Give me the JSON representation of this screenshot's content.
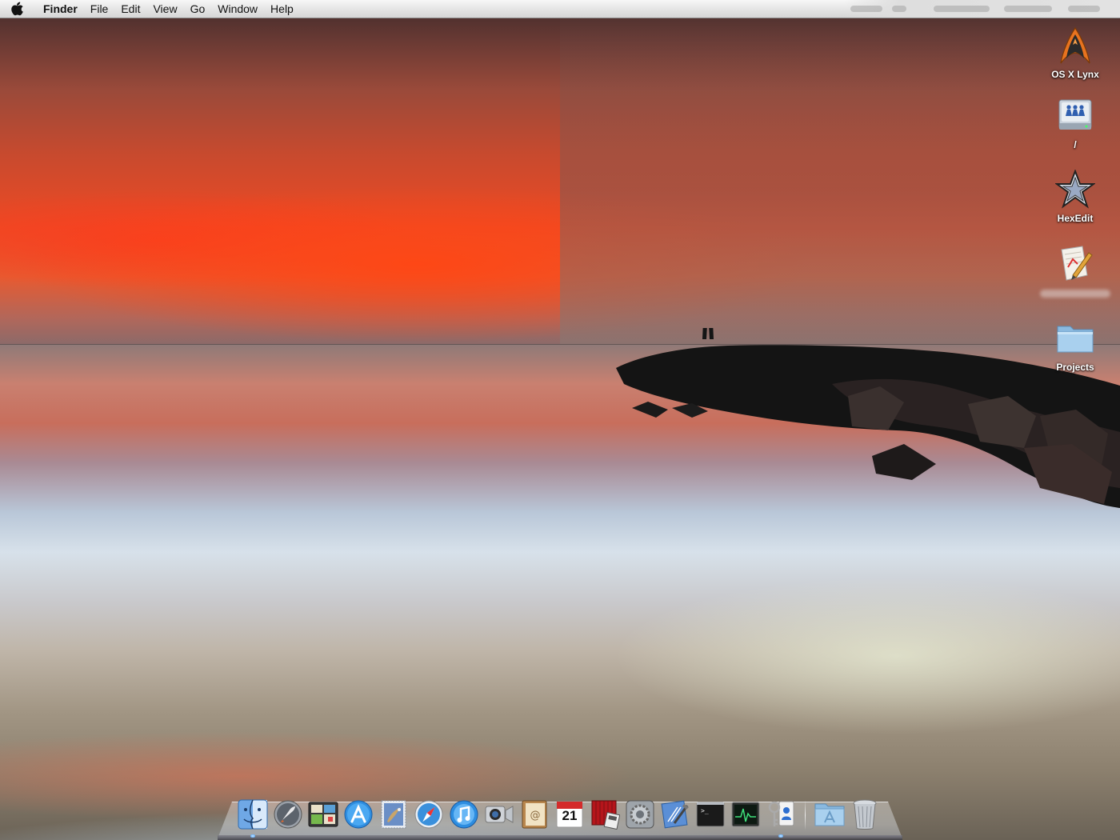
{
  "menubar": {
    "apple_icon": "apple-logo-icon",
    "app_name": "Finder",
    "menus": [
      "File",
      "Edit",
      "View",
      "Go",
      "Window",
      "Help"
    ]
  },
  "desktop": {
    "icons": [
      {
        "label": "OS X Lynx",
        "icon": "starfleet-insignia-icon"
      },
      {
        "label": "/",
        "icon": "network-drive-icon"
      },
      {
        "label": "HexEdit",
        "icon": "pentagram-star-icon"
      },
      {
        "label": "",
        "icon": "document-pen-icon"
      },
      {
        "label": "Projects",
        "icon": "folder-icon"
      }
    ]
  },
  "dock": {
    "apps": [
      {
        "icon": "finder-icon",
        "running": true
      },
      {
        "icon": "launchpad-rocket-icon",
        "running": false
      },
      {
        "icon": "photo-booth-icon",
        "running": false
      },
      {
        "icon": "app-store-icon",
        "running": false
      },
      {
        "icon": "mail-stamp-icon",
        "running": false
      },
      {
        "icon": "safari-compass-icon",
        "running": false
      },
      {
        "icon": "itunes-icon",
        "running": false
      },
      {
        "icon": "facetime-camera-icon",
        "running": false
      },
      {
        "icon": "address-book-icon",
        "running": false
      },
      {
        "icon": "calendar-icon",
        "running": false,
        "day": "21"
      },
      {
        "icon": "photo-booth-curtain-icon",
        "running": false
      },
      {
        "icon": "system-preferences-icon",
        "running": false
      },
      {
        "icon": "xcode-icon",
        "running": false
      },
      {
        "icon": "terminal-icon",
        "running": false
      },
      {
        "icon": "activity-monitor-icon",
        "running": false
      },
      {
        "icon": "keychain-access-icon",
        "running": true
      }
    ],
    "stacks": [
      {
        "icon": "applications-folder-icon"
      },
      {
        "icon": "trash-icon"
      }
    ]
  }
}
